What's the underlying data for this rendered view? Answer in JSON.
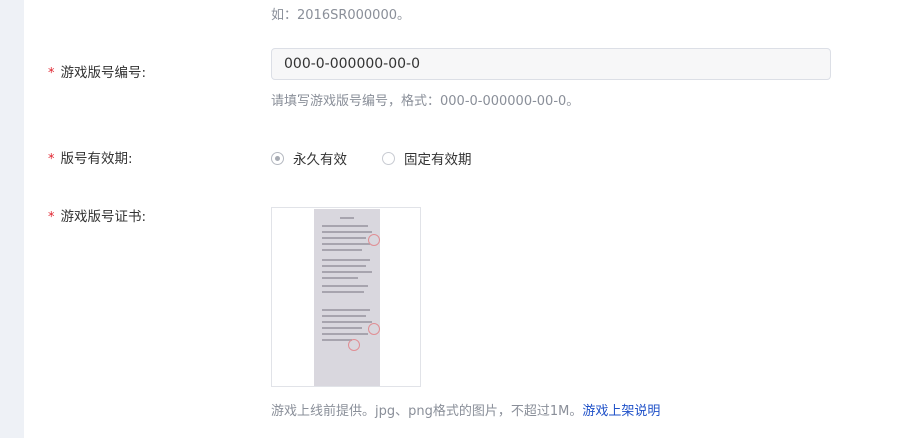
{
  "form": {
    "top_hint": "如：2016SR000000。",
    "version_no": {
      "required_mark": "*",
      "label": "游戏版号编号:",
      "value": "000-0-000000-00-0",
      "hint": "请填写游戏版号编号，格式：000-0-000000-00-0。"
    },
    "validity": {
      "required_mark": "*",
      "label": "版号有效期:",
      "options": [
        {
          "label": "永久有效",
          "checked": true
        },
        {
          "label": "固定有效期",
          "checked": false
        }
      ]
    },
    "certificate": {
      "required_mark": "*",
      "label": "游戏版号证书:",
      "hint": "游戏上线前提供。jpg、png格式的图片，不超过1M。",
      "link": "游戏上架说明"
    }
  },
  "colors": {
    "required": "#e0242f",
    "link": "#1e50c8",
    "page_bg": "#eef1f6"
  }
}
